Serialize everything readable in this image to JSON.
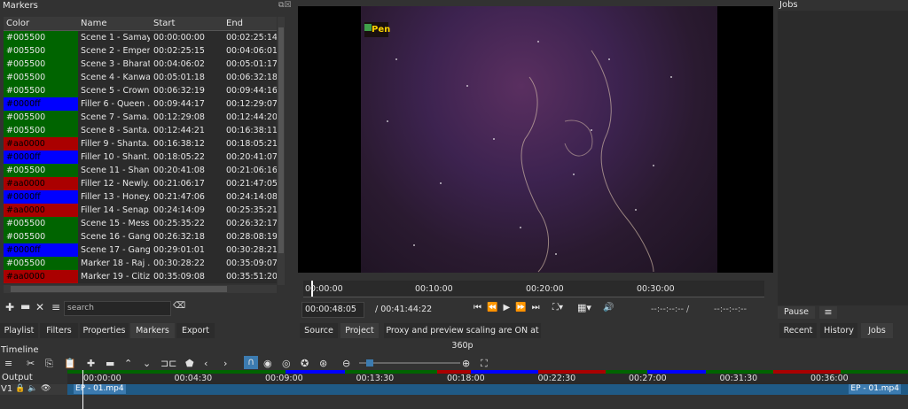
{
  "markers": {
    "title": "Markers",
    "columns": [
      "Color",
      "Name",
      "Start",
      "End"
    ],
    "rows": [
      {
        "color": "#005500",
        "name": "Scene 1 - Samay",
        "start": "00:00:00:00",
        "end": "00:02:25:14"
      },
      {
        "color": "#005500",
        "name": "Scene 2 - Emper...",
        "start": "00:02:25:15",
        "end": "00:04:06:01"
      },
      {
        "color": "#005500",
        "name": "Scene 3 - Bharat...",
        "start": "00:04:06:02",
        "end": "00:05:01:17"
      },
      {
        "color": "#005500",
        "name": "Scene 4 - Kanwa...",
        "start": "00:05:01:18",
        "end": "00:06:32:18"
      },
      {
        "color": "#005500",
        "name": "Scene 5 - Crown...",
        "start": "00:06:32:19",
        "end": "00:09:44:16"
      },
      {
        "color": "#0000ff",
        "name": "Filler 6 - Queen ...",
        "start": "00:09:44:17",
        "end": "00:12:29:07"
      },
      {
        "color": "#005500",
        "name": "Scene 7 - Sama...",
        "start": "00:12:29:08",
        "end": "00:12:44:20"
      },
      {
        "color": "#005500",
        "name": "Scene 8 - Santa...",
        "start": "00:12:44:21",
        "end": "00:16:38:11"
      },
      {
        "color": "#aa0000",
        "name": "Filler 9 - Shanta...",
        "start": "00:16:38:12",
        "end": "00:18:05:21"
      },
      {
        "color": "#0000ff",
        "name": "Filler 10 - Shant...",
        "start": "00:18:05:22",
        "end": "00:20:41:07"
      },
      {
        "color": "#005500",
        "name": "Scene 11 - Shan...",
        "start": "00:20:41:08",
        "end": "00:21:06:16"
      },
      {
        "color": "#aa0000",
        "name": "Filler 12 - Newly...",
        "start": "00:21:06:17",
        "end": "00:21:47:05"
      },
      {
        "color": "#0000ff",
        "name": "Filler 13 - Honey...",
        "start": "00:21:47:06",
        "end": "00:24:14:08"
      },
      {
        "color": "#aa0000",
        "name": "Filler 14 - Senap...",
        "start": "00:24:14:09",
        "end": "00:25:35:21"
      },
      {
        "color": "#005500",
        "name": "Scene 15 - Mess...",
        "start": "00:25:35:22",
        "end": "00:26:32:17"
      },
      {
        "color": "#005500",
        "name": "Scene 16 - Gang...",
        "start": "00:26:32:18",
        "end": "00:28:08:19"
      },
      {
        "color": "#0000ff",
        "name": "Scene 17 - Gang...",
        "start": "00:29:01:01",
        "end": "00:30:28:21"
      },
      {
        "color": "#005500",
        "name": "Marker 18 - Raj ...",
        "start": "00:30:28:22",
        "end": "00:35:09:07"
      },
      {
        "color": "#aa0000",
        "name": "Marker 19 - Citiz...",
        "start": "00:35:09:08",
        "end": "00:35:51:20"
      }
    ],
    "search_placeholder": "search"
  },
  "left_tabs": [
    "Playlist",
    "Filters",
    "Properties",
    "Markers",
    "Export"
  ],
  "player": {
    "logo": "Pen",
    "ruler_ticks": [
      "00:00:00",
      "00:10:00",
      "00:20:00",
      "00:30:00"
    ],
    "current_time": "00:00:48:05",
    "total_time": "/ 00:41:44:22",
    "in_point": "--:--:--:-- /",
    "out_point": "--:--:--:--",
    "tabs": [
      "Source",
      "Project"
    ],
    "status": "Proxy and preview scaling are ON at 360p"
  },
  "jobs": {
    "title": "Jobs",
    "pause_label": "Pause",
    "tabs": [
      "Recent",
      "History",
      "Jobs"
    ]
  },
  "timeline": {
    "title": "Timeline",
    "output_label": "Output",
    "track_label": "V1",
    "ruler_ticks": [
      "00:00:00",
      "00:04:30",
      "00:09:00",
      "00:13:30",
      "00:18:00",
      "00:22:30",
      "00:27:00",
      "00:31:30",
      "00:36:00"
    ],
    "clip_name": "EP - 01.mp4"
  },
  "colors": {
    "green": "#006400",
    "blue": "#0000ff",
    "red": "#aa0000",
    "accent": "#3c7bb0"
  }
}
